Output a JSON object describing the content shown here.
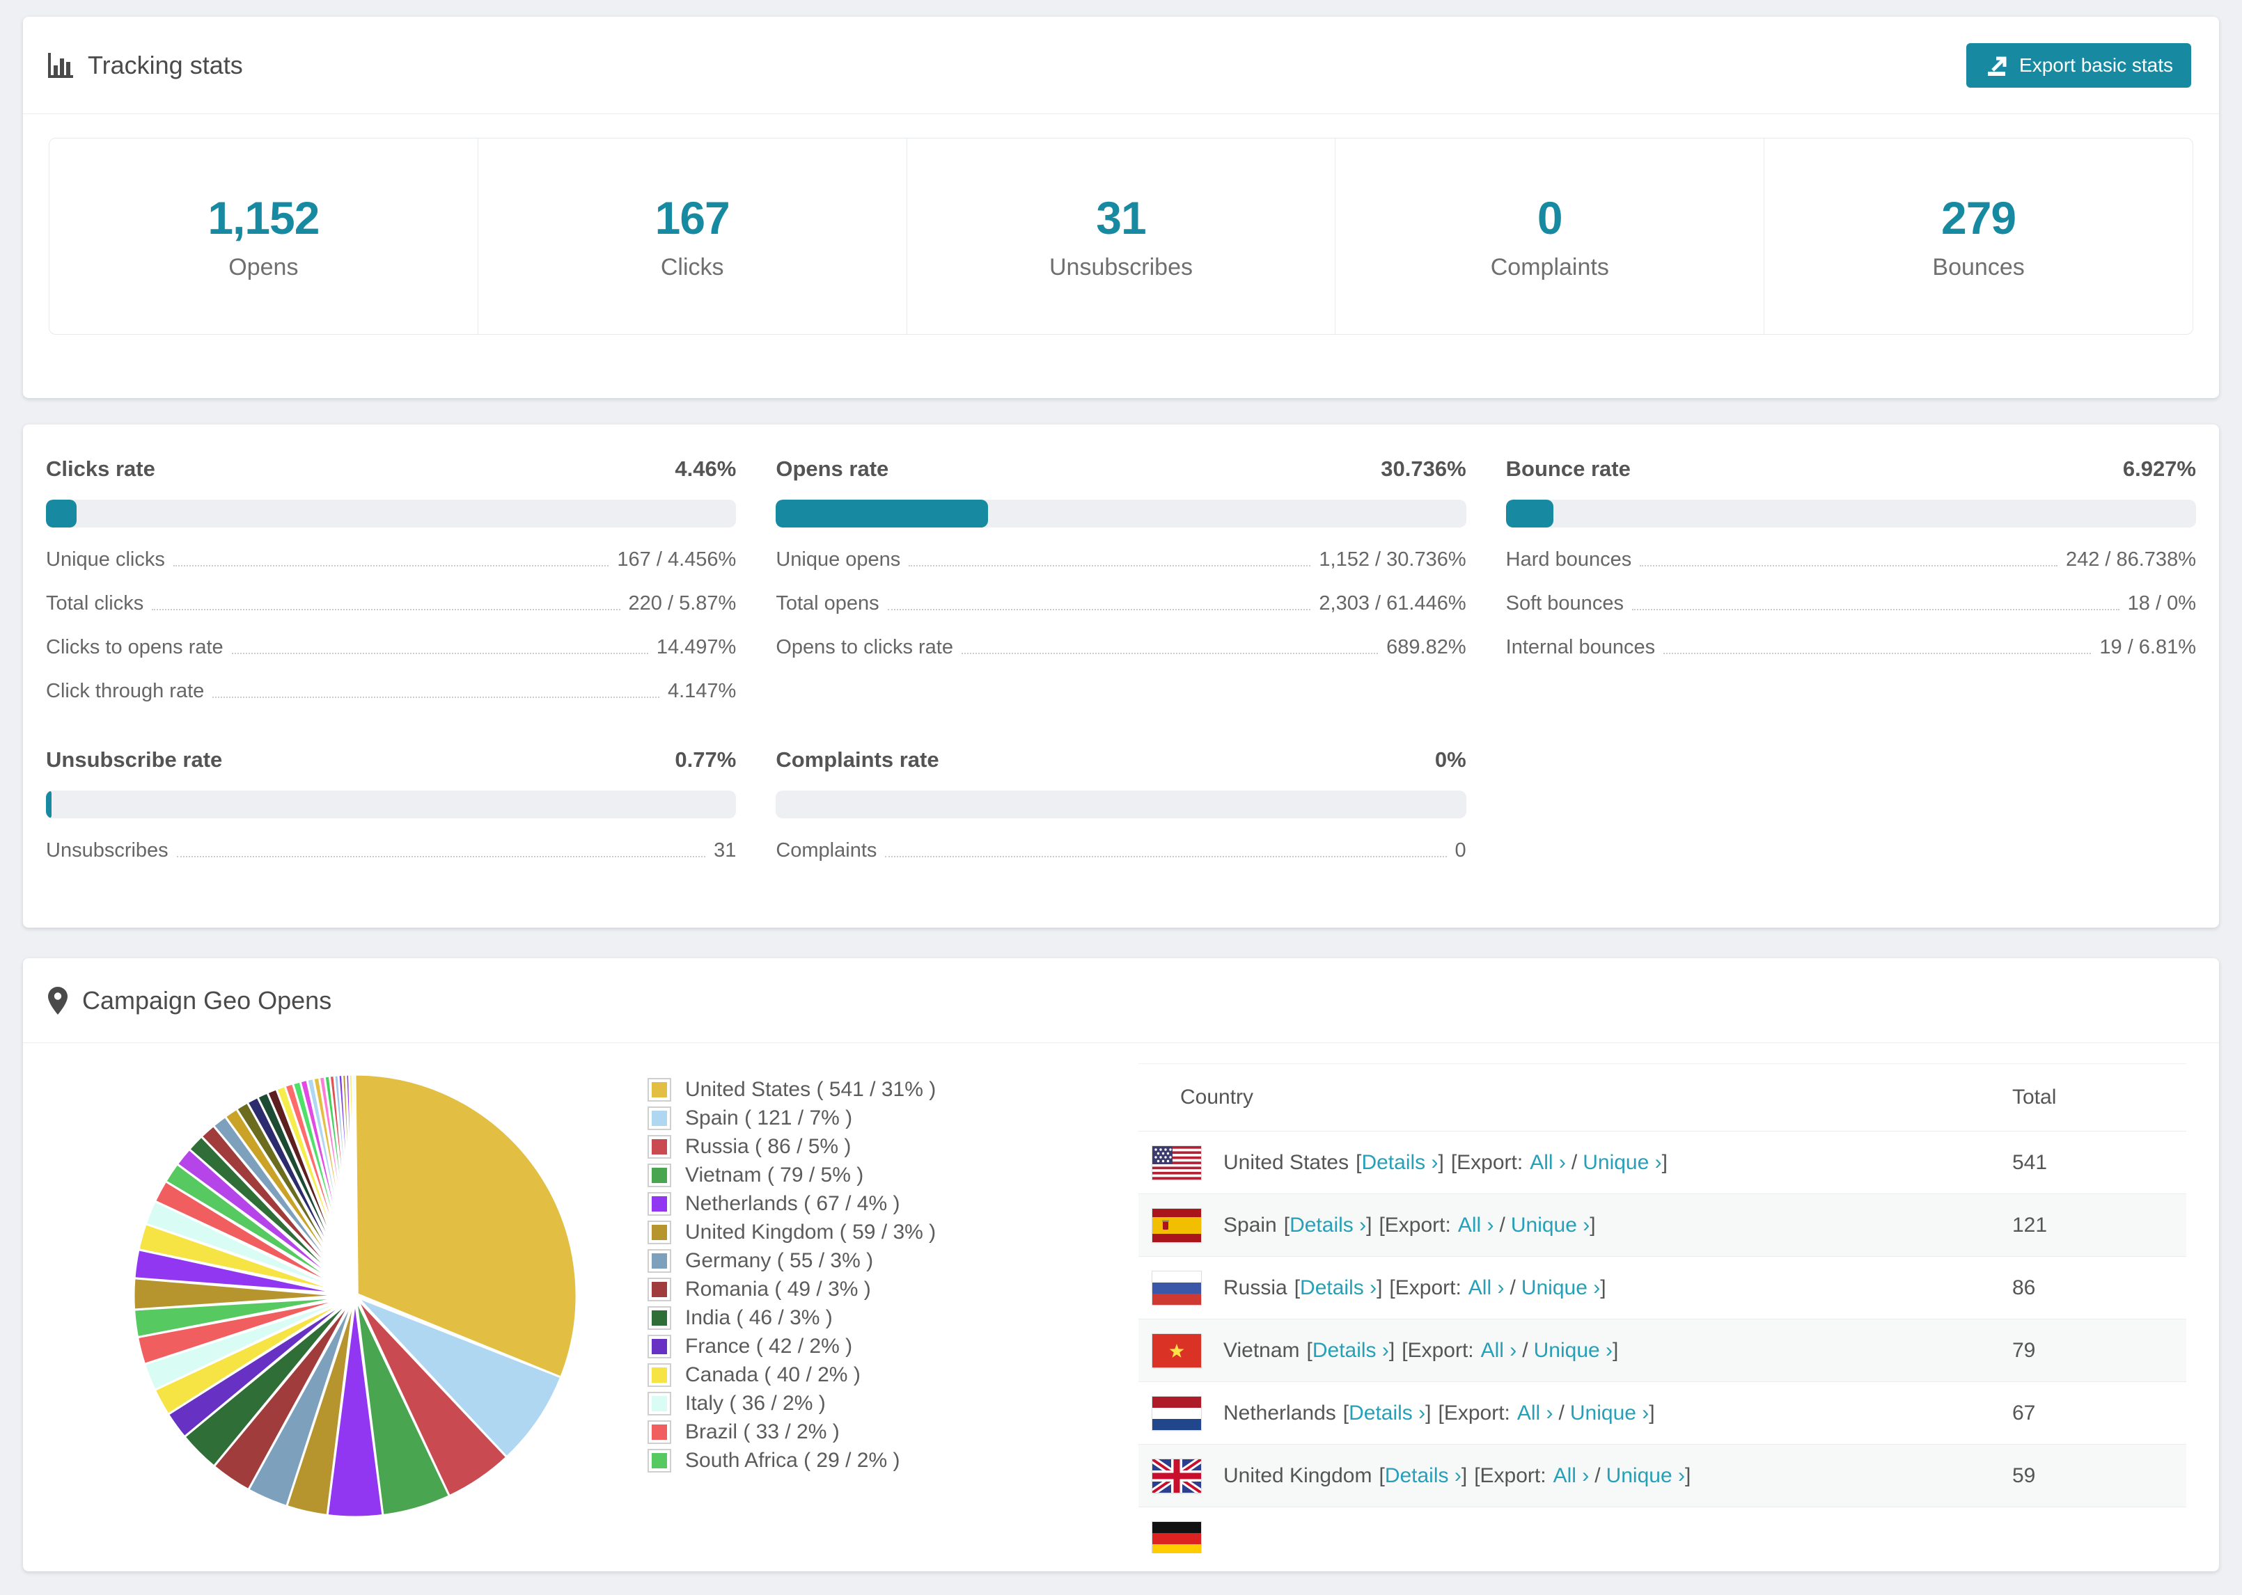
{
  "colors": {
    "accent": "#1789A1",
    "link": "#26A0B8"
  },
  "tracking": {
    "icon": "bar-chart-icon",
    "title": "Tracking stats",
    "export_button": "Export basic stats",
    "stats": [
      {
        "value": "1,152",
        "label": "Opens"
      },
      {
        "value": "167",
        "label": "Clicks"
      },
      {
        "value": "31",
        "label": "Unsubscribes"
      },
      {
        "value": "0",
        "label": "Complaints"
      },
      {
        "value": "279",
        "label": "Bounces"
      }
    ]
  },
  "rates": {
    "sections": [
      {
        "title": "Clicks rate",
        "value": "4.46%",
        "pct": 4.46,
        "rows": [
          {
            "label": "Unique clicks",
            "value": "167 / 4.456%"
          },
          {
            "label": "Total clicks",
            "value": "220 / 5.87%"
          },
          {
            "label": "Clicks to opens rate",
            "value": "14.497%"
          },
          {
            "label": "Click through rate",
            "value": "4.147%"
          }
        ]
      },
      {
        "title": "Opens rate",
        "value": "30.736%",
        "pct": 30.736,
        "rows": [
          {
            "label": "Unique opens",
            "value": "1,152 / 30.736%"
          },
          {
            "label": "Total opens",
            "value": "2,303 / 61.446%"
          },
          {
            "label": "Opens to clicks rate",
            "value": "689.82%"
          }
        ]
      },
      {
        "title": "Bounce rate",
        "value": "6.927%",
        "pct": 6.927,
        "rows": [
          {
            "label": "Hard bounces",
            "value": "242 / 86.738%"
          },
          {
            "label": "Soft bounces",
            "value": "18 / 0%"
          },
          {
            "label": "Internal bounces",
            "value": "19 / 6.81%"
          }
        ]
      },
      {
        "title": "Unsubscribe rate",
        "value": "0.77%",
        "pct": 0.77,
        "rows": [
          {
            "label": "Unsubscribes",
            "value": "31"
          }
        ]
      },
      {
        "title": "Complaints rate",
        "value": "0%",
        "pct": 0,
        "rows": [
          {
            "label": "Complaints",
            "value": "0"
          }
        ]
      }
    ]
  },
  "geo": {
    "icon": "map-pin-icon",
    "title": "Campaign Geo Opens",
    "chart_data": {
      "type": "pie",
      "title": "Campaign Geo Opens",
      "labels": [
        "United States",
        "Spain",
        "Russia",
        "Vietnam",
        "Netherlands",
        "United Kingdom",
        "Germany",
        "Romania",
        "India",
        "France",
        "Canada",
        "Italy",
        "Brazil",
        "South Africa"
      ],
      "values": [
        541,
        121,
        86,
        79,
        67,
        59,
        55,
        49,
        46,
        42,
        40,
        36,
        33,
        29
      ],
      "pcts": [
        31,
        7,
        5,
        5,
        4,
        3,
        3,
        3,
        3,
        2,
        2,
        2,
        2,
        2
      ],
      "colors": [
        "#E2BE42",
        "#AFD7F2",
        "#C94A50",
        "#4AA551",
        "#9137F2",
        "#B6952F",
        "#7DA0BC",
        "#A03C3C",
        "#2F6F37",
        "#6731C3",
        "#F6E344",
        "#D9FDF4",
        "#F05E60",
        "#57C961"
      ],
      "legend_position": "right",
      "start_angle_deg": 0,
      "direction": "clockwise",
      "tail": {
        "note": "remaining smaller countries rendered as progressively thinner exploded slices",
        "count": 30,
        "start": 2.4,
        "ratio": 0.92,
        "total_pct": 26,
        "palette": [
          "#B6952F",
          "#9137F2",
          "#F6E344",
          "#D9FDF4",
          "#F05E60",
          "#57C961",
          "#B545E8",
          "#2F6F37",
          "#A03C3C",
          "#7DA0BC",
          "#C9A227",
          "#6C6C1F",
          "#2B2B6E",
          "#1C4A33",
          "#5E1F1F",
          "#F4ED4B",
          "#FF6B6B",
          "#4FE06A",
          "#E14BE1",
          "#AFD7F2",
          "#E2BE42",
          "#FF7BD5",
          "#44D05C",
          "#E05252",
          "#9FC6EC",
          "#7A3CE8"
        ]
      }
    },
    "legend": [
      {
        "label": "United States ( 541 / 31% )"
      },
      {
        "label": "Spain ( 121 / 7% )"
      },
      {
        "label": "Russia ( 86 / 5% )"
      },
      {
        "label": "Vietnam ( 79 / 5% )"
      },
      {
        "label": "Netherlands ( 67 / 4% )"
      },
      {
        "label": "United Kingdom ( 59 / 3% )"
      },
      {
        "label": "Germany ( 55 / 3% )"
      },
      {
        "label": "Romania ( 49 / 3% )"
      },
      {
        "label": "India ( 46 / 3% )"
      },
      {
        "label": "France ( 42 / 2% )"
      },
      {
        "label": "Canada ( 40 / 2% )"
      },
      {
        "label": "Italy ( 36 / 2% )"
      },
      {
        "label": "Brazil ( 33 / 2% )"
      },
      {
        "label": "South Africa ( 29 / 2% )"
      }
    ],
    "table": {
      "headers": {
        "country": "Country",
        "total": "Total"
      },
      "labels": {
        "lb": "[",
        "rb": "]",
        "details": "Details ›",
        "export_prefix": "[Export:",
        "all": "All ›",
        "slash": "/",
        "unique": "Unique ›"
      },
      "rows": [
        {
          "country": "United States",
          "total": "541",
          "flag": "us-flag-icon"
        },
        {
          "country": "Spain",
          "total": "121",
          "flag": "es-flag-icon"
        },
        {
          "country": "Russia",
          "total": "86",
          "flag": "ru-flag-icon"
        },
        {
          "country": "Vietnam",
          "total": "79",
          "flag": "vn-flag-icon"
        },
        {
          "country": "Netherlands",
          "total": "67",
          "flag": "nl-flag-icon"
        },
        {
          "country": "United Kingdom",
          "total": "59",
          "flag": "gb-flag-icon"
        }
      ],
      "partial_row": {
        "flag": "de-flag-icon"
      }
    }
  }
}
